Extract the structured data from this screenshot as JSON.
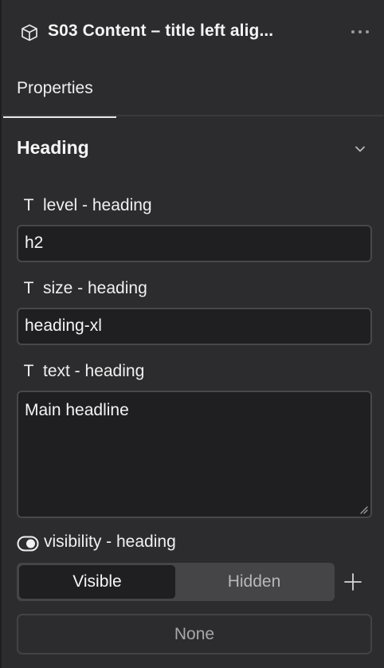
{
  "header": {
    "title": "S03 Content – title left alig...",
    "component_icon": "cube-icon",
    "more_icon": "more-horizontal-icon"
  },
  "tabs": [
    {
      "label": "Properties",
      "active": true
    }
  ],
  "section": {
    "title": "Heading",
    "expanded": true,
    "chevron_icon": "chevron-down-icon"
  },
  "fields": {
    "level": {
      "type_glyph": "T",
      "label": "level - heading",
      "value": "h2"
    },
    "size": {
      "type_glyph": "T",
      "label": "size - heading",
      "value": "heading-xl"
    },
    "text": {
      "type_glyph": "T",
      "label": "text - heading",
      "value": "Main headline"
    }
  },
  "visibility": {
    "label": "visibility - heading",
    "icon": "toggle-icon",
    "options": [
      "Visible",
      "Hidden"
    ],
    "selected": "Visible",
    "add_icon": "plus-icon"
  },
  "none_button": {
    "label": "None"
  },
  "colors": {
    "panel_bg": "#2c2c2e",
    "input_bg": "#1f1e21",
    "input_border": "#48474b",
    "text": "#f2f2f2",
    "muted_text": "#a7a7aa"
  }
}
